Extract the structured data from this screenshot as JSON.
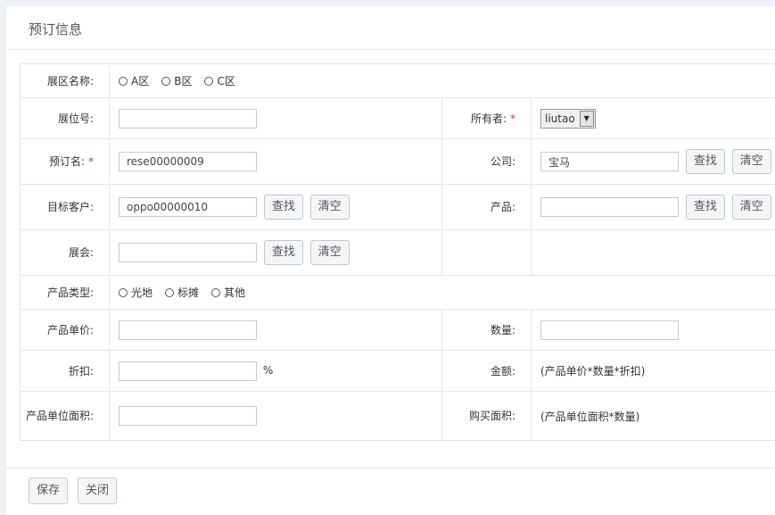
{
  "panel": {
    "title": "预订信息"
  },
  "form": {
    "zone": {
      "label": "展区名称:",
      "options": [
        "A区",
        "B区",
        "C区"
      ]
    },
    "booth_no": {
      "label": "展位号:",
      "value": ""
    },
    "owner": {
      "label": "所有者:",
      "required_mark": "*",
      "selected": "liutao"
    },
    "booking_name": {
      "label": "预订名:",
      "required_mark": "*",
      "value": "rese00000009"
    },
    "company": {
      "label": "公司:",
      "value": "宝马"
    },
    "target_customer": {
      "label": "目标客户:",
      "value": "oppo00000010"
    },
    "product": {
      "label": "产品:",
      "value": ""
    },
    "exhibition": {
      "label": "展会:",
      "value": ""
    },
    "product_type": {
      "label": "产品类型:",
      "options": [
        "光地",
        "标摊",
        "其他"
      ]
    },
    "unit_price": {
      "label": "产品单价:",
      "value": ""
    },
    "quantity": {
      "label": "数量:",
      "value": ""
    },
    "discount": {
      "label": "折扣:",
      "value": "",
      "unit": "%"
    },
    "amount": {
      "label": "金额:",
      "hint": "(产品单价*数量*折扣)"
    },
    "unit_area": {
      "label": "产品单位面积:",
      "value": ""
    },
    "purchase_area": {
      "label": "购买面积:",
      "hint": "(产品单位面积*数量)"
    }
  },
  "buttons": {
    "find": "查找",
    "clear": "清空",
    "save": "保存",
    "close": "关闭"
  }
}
